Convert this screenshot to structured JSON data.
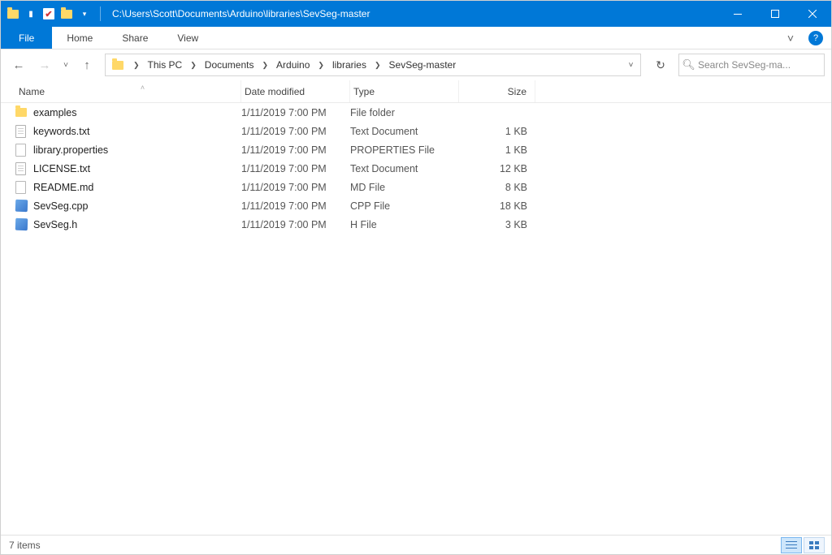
{
  "title": "C:\\Users\\Scott\\Documents\\Arduino\\libraries\\SevSeg-master",
  "ribbon": {
    "file": "File",
    "home": "Home",
    "share": "Share",
    "view": "View"
  },
  "breadcrumbs": [
    "This PC",
    "Documents",
    "Arduino",
    "libraries",
    "SevSeg-master"
  ],
  "search_placeholder": "Search SevSeg-ma...",
  "columns": {
    "name": "Name",
    "date": "Date modified",
    "type": "Type",
    "size": "Size"
  },
  "files": [
    {
      "name": "examples",
      "date": "1/11/2019 7:00 PM",
      "type": "File folder",
      "size": "",
      "icon": "folder"
    },
    {
      "name": "keywords.txt",
      "date": "1/11/2019 7:00 PM",
      "type": "Text Document",
      "size": "1 KB",
      "icon": "doc"
    },
    {
      "name": "library.properties",
      "date": "1/11/2019 7:00 PM",
      "type": "PROPERTIES File",
      "size": "1 KB",
      "icon": "blank"
    },
    {
      "name": "LICENSE.txt",
      "date": "1/11/2019 7:00 PM",
      "type": "Text Document",
      "size": "12 KB",
      "icon": "doc"
    },
    {
      "name": "README.md",
      "date": "1/11/2019 7:00 PM",
      "type": "MD File",
      "size": "8 KB",
      "icon": "blank"
    },
    {
      "name": "SevSeg.cpp",
      "date": "1/11/2019 7:00 PM",
      "type": "CPP File",
      "size": "18 KB",
      "icon": "code"
    },
    {
      "name": "SevSeg.h",
      "date": "1/11/2019 7:00 PM",
      "type": "H File",
      "size": "3 KB",
      "icon": "code"
    }
  ],
  "status": "7 items"
}
